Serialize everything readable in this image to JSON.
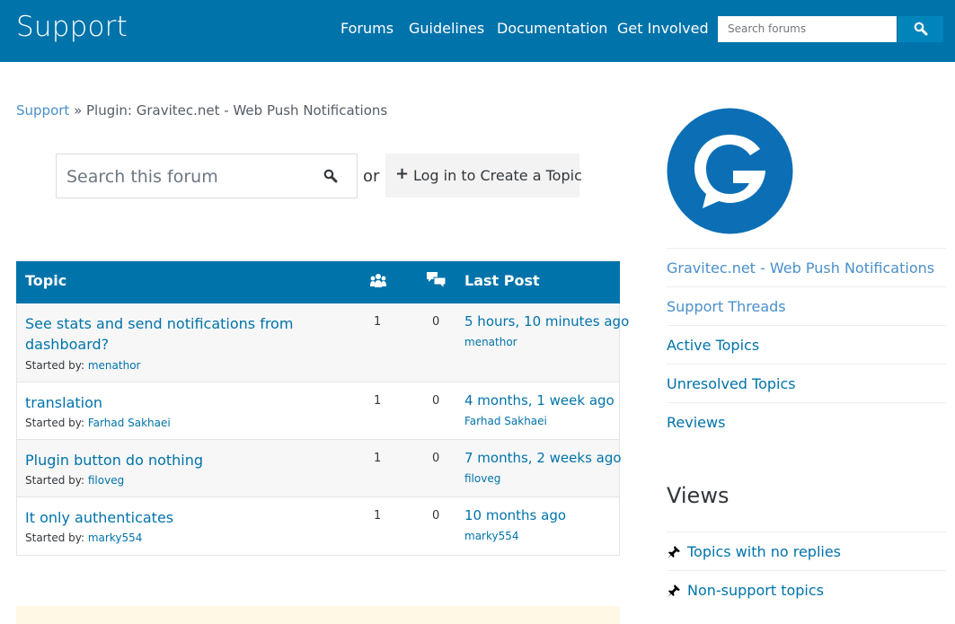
{
  "header": {
    "brand": "Support",
    "nav": [
      "Forums",
      "Guidelines",
      "Documentation",
      "Get Involved"
    ],
    "search_placeholder": "Search forums"
  },
  "breadcrumb": {
    "root": "Support",
    "separator": " » ",
    "current": "Plugin: Gravitec.net - Web Push Notifications"
  },
  "forum_actions": {
    "search_placeholder": "Search this forum",
    "or_text": "or",
    "login_plus": "+",
    "login_label": "Log in to Create a Topic"
  },
  "topics_table": {
    "columns": {
      "topic": "Topic",
      "voices_icon": "people-icon",
      "replies_icon": "speech-bubbles-icon",
      "last_post": "Last Post"
    },
    "started_by_label": "Started by:",
    "rows": [
      {
        "title": "See stats and send notifications from dashboard?",
        "author": "menathor",
        "voices": "1",
        "replies": "0",
        "last_post": "5 hours, 10 minutes ago",
        "last_by": "menathor"
      },
      {
        "title": "translation",
        "author": "Farhad Sakhaei",
        "voices": "1",
        "replies": "0",
        "last_post": "4 months, 1 week ago",
        "last_by": "Farhad Sakhaei"
      },
      {
        "title": "Plugin button do nothing",
        "author": "filoveg",
        "voices": "1",
        "replies": "0",
        "last_post": "7 months, 2 weeks ago",
        "last_by": "filoveg"
      },
      {
        "title": "It only authenticates",
        "author": "marky554",
        "voices": "1",
        "replies": "0",
        "last_post": "10 months ago",
        "last_by": "marky554"
      }
    ]
  },
  "sidebar": {
    "items": [
      {
        "label": "Gravitec.net - Web Push Notifications",
        "color": "#4a8fc9"
      },
      {
        "label": "Support Threads",
        "color": "#4a8fc9"
      },
      {
        "label": "Active Topics",
        "color": "#0073aa"
      },
      {
        "label": "Unresolved Topics",
        "color": "#0073aa"
      },
      {
        "label": "Reviews",
        "color": "#0073aa"
      }
    ],
    "views_heading": "Views",
    "views": [
      "Topics with no replies",
      "Non-support topics"
    ]
  },
  "colors": {
    "brand_blue": "#0073aa",
    "search_button": "#0085ba",
    "notice_bg": "#fff8e5"
  }
}
